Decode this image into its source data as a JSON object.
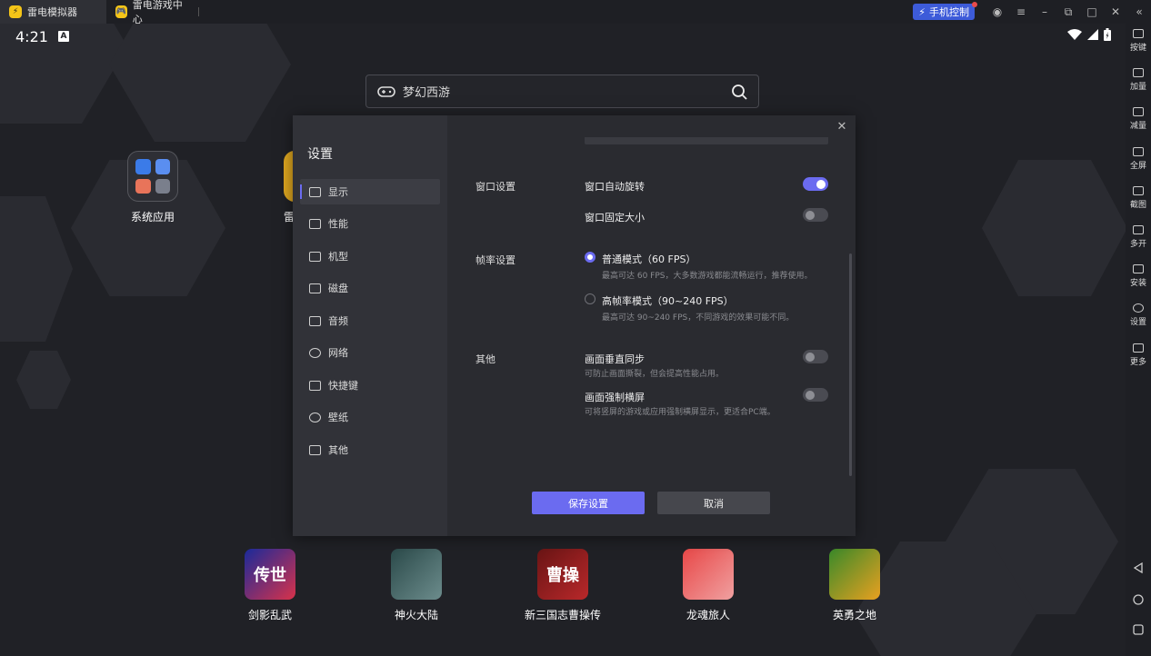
{
  "titlebar": {
    "tabs": [
      {
        "label": "雷电模拟器",
        "active": true
      },
      {
        "label": "雷电游戏中心",
        "active": false
      }
    ],
    "phone_control": "手机控制"
  },
  "statusbar": {
    "time": "4:21",
    "a_icon": "A"
  },
  "search": {
    "text": "梦幻西游"
  },
  "apps": {
    "system": "系统应用",
    "hidden_partial": "雷",
    "bottom": [
      {
        "label": "剑影乱武",
        "glyph": "传世",
        "color": "#2a3bb8"
      },
      {
        "label": "神火大陆",
        "glyph": "",
        "color": "#3a5a5a"
      },
      {
        "label": "新三国志曹操传",
        "glyph": "曹操",
        "color": "#8b1a1a"
      },
      {
        "label": "龙魂旅人",
        "glyph": "",
        "color": "#d83a3a"
      },
      {
        "label": "英勇之地",
        "glyph": "",
        "color": "#3f8a2f"
      }
    ]
  },
  "settings": {
    "title": "设置",
    "nav": [
      "显示",
      "性能",
      "机型",
      "磁盘",
      "音频",
      "网络",
      "快捷键",
      "壁纸",
      "其他"
    ],
    "window_section": "窗口设置",
    "auto_rotate": "窗口自动旋转",
    "auto_rotate_on": true,
    "fixed_size": "窗口固定大小",
    "fixed_size_on": false,
    "fps_section": "帧率设置",
    "normal_mode": "普通模式（60 FPS）",
    "normal_mode_desc": "最高可达 60 FPS，大多数游戏都能流畅运行，推荐使用。",
    "high_mode": "高帧率模式（90~240 FPS）",
    "high_mode_desc": "最高可达 90~240 FPS，不同游戏的效果可能不同。",
    "other_section": "其他",
    "vsync": "画面垂直同步",
    "vsync_desc": "可防止画面撕裂，但会提高性能占用。",
    "vsync_on": false,
    "force_landscape": "画面强制横屏",
    "force_landscape_desc": "可将竖屏的游戏或应用强制横屏显示，更适合PC端。",
    "force_landscape_on": false,
    "save": "保存设置",
    "cancel": "取消"
  },
  "right_toolbar": [
    "按键",
    "加量",
    "减量",
    "全屏",
    "截图",
    "多开",
    "安装",
    "设置",
    "更多"
  ],
  "colors": {
    "accent": "#6b6bf0",
    "phone_control": "#3d5bd9"
  }
}
